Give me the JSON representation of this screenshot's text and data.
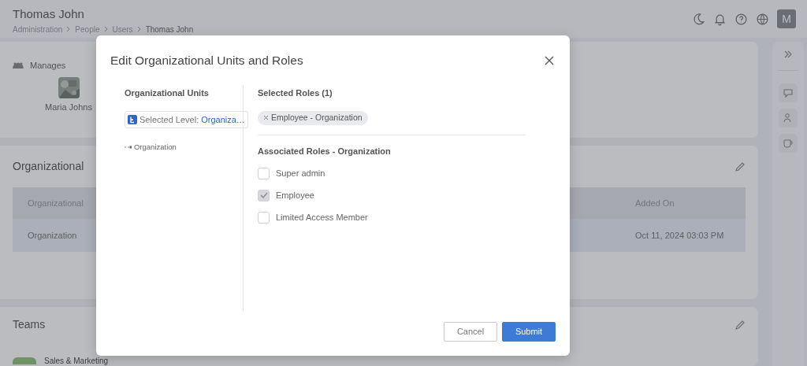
{
  "header": {
    "title": "Thomas John",
    "breadcrumb": [
      "Administration",
      "People",
      "Users",
      "Thomas John"
    ],
    "avatar": "M"
  },
  "manages": {
    "title": "Manages",
    "people": [
      {
        "name": "Maria Johns"
      }
    ]
  },
  "org_units_card": {
    "title": "Organizational",
    "table": {
      "columns": [
        "Organizational",
        "Added On"
      ],
      "rows": [
        [
          "Organization",
          "Oct 11, 2024 03:03 PM"
        ]
      ]
    }
  },
  "teams_card": {
    "title": "Teams",
    "teams": [
      {
        "name": "Sales & Marketing"
      }
    ]
  },
  "modal": {
    "title": "Edit Organizational Units and Roles",
    "units": {
      "heading": "Organizational Units",
      "selected_level_label": "Selected Level:",
      "selected_level_value": "Organiza…",
      "tree": [
        {
          "label": "Organization"
        }
      ]
    },
    "roles": {
      "heading": "Selected Roles (1)",
      "chips": [
        "Employee - Organization"
      ],
      "associated_heading": "Associated Roles - Organization",
      "items": [
        {
          "label": "Super admin",
          "checked": false,
          "disabled": false
        },
        {
          "label": "Employee",
          "checked": true,
          "disabled": true
        },
        {
          "label": "Limited Access Member",
          "checked": false,
          "disabled": false
        }
      ]
    },
    "buttons": [
      {
        "label": "Cancel",
        "kind": "secondary"
      },
      {
        "label": "Submit",
        "kind": "primary"
      }
    ]
  }
}
